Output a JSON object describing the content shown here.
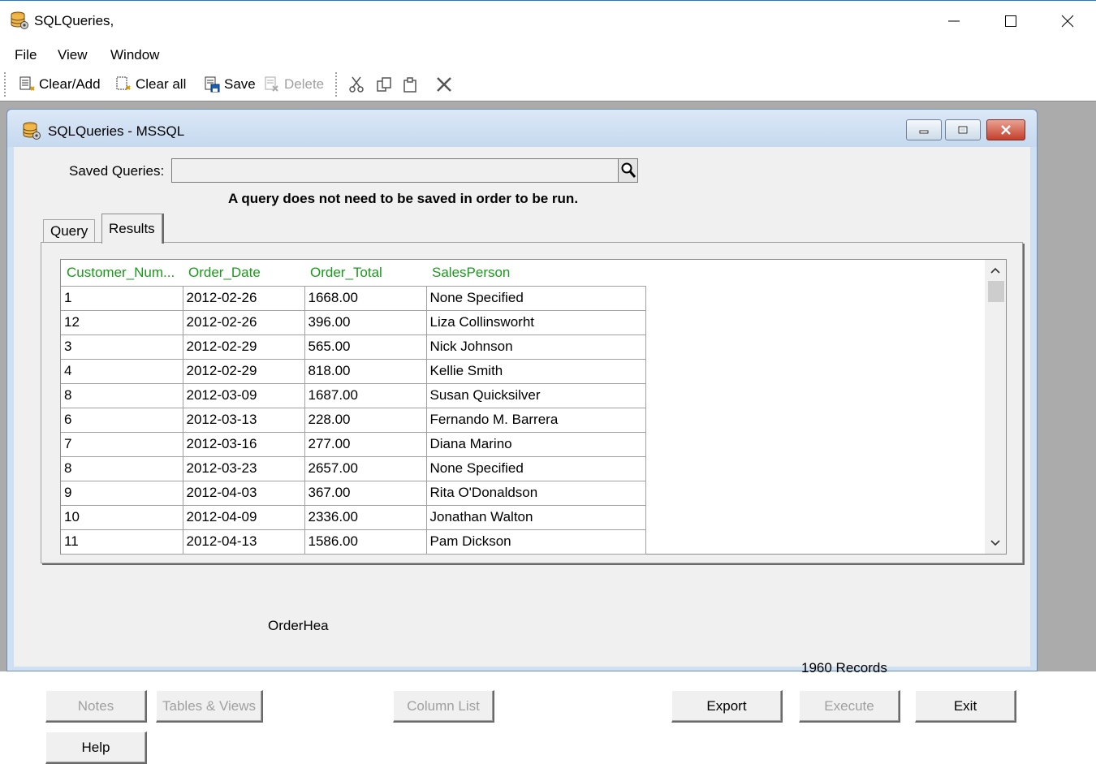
{
  "app": {
    "title": "SQLQueries,",
    "menu": [
      "File",
      "View",
      "Window"
    ]
  },
  "toolbar": {
    "clear_add": "Clear/Add",
    "clear_all": "Clear all",
    "save": "Save",
    "delete": "Delete"
  },
  "child_window": {
    "title": "SQLQueries - MSSQL"
  },
  "saved_queries": {
    "label": "Saved Queries:",
    "value": "",
    "note": "A query does not need to be saved in order to be run."
  },
  "tabs": [
    "Query",
    "Results"
  ],
  "active_tab": "Results",
  "results": {
    "columns": [
      "Customer_Num...",
      "Order_Date",
      "Order_Total",
      "SalesPerson"
    ],
    "rows": [
      [
        "1",
        "2012-02-26",
        "1668.00",
        "None Specified"
      ],
      [
        "12",
        "2012-02-26",
        "396.00",
        "Liza Collinsworht"
      ],
      [
        "3",
        "2012-02-29",
        "565.00",
        "Nick Johnson"
      ],
      [
        "4",
        "2012-02-29",
        "818.00",
        "Kellie Smith"
      ],
      [
        "8",
        "2012-03-09",
        "1687.00",
        "Susan Quicksilver"
      ],
      [
        "6",
        "2012-03-13",
        "228.00",
        "Fernando M. Barrera"
      ],
      [
        "7",
        "2012-03-16",
        "277.00",
        "Diana Marino"
      ],
      [
        "8",
        "2012-03-23",
        "2657.00",
        "None Specified"
      ],
      [
        "9",
        "2012-04-03",
        "367.00",
        "Rita O'Donaldson"
      ],
      [
        "10",
        "2012-04-09",
        "2336.00",
        "Jonathan Walton"
      ],
      [
        "11",
        "2012-04-13",
        "1586.00",
        "Pam Dickson"
      ]
    ]
  },
  "buttons": {
    "notes": "Notes",
    "tables_views": "Tables & Views",
    "column_list": "Column List",
    "export": "Export",
    "execute": "Execute",
    "exit": "Exit",
    "help": "Help"
  },
  "table_name": "OrderHea",
  "record_count": "1960 Records",
  "colors": {
    "column_header": "#1a9a1a",
    "mdi_background": "#ababab",
    "child_frame": "#cfe0f3",
    "disabled_text": "#a0a0a0"
  }
}
